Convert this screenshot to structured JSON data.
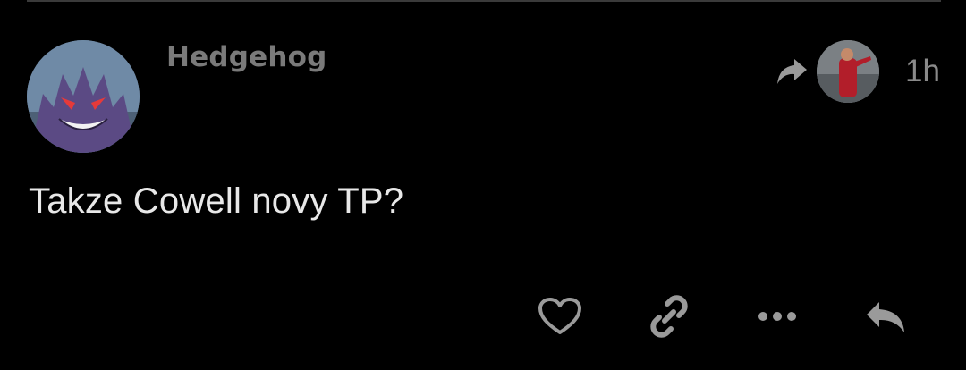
{
  "post": {
    "author": "Hedgehog",
    "time": "1h",
    "text": "Takze Cowell novy TP?"
  },
  "icons": {
    "avatar": "avatar-image",
    "boost": "boost-arrow-icon",
    "boost_avatar": "booster-avatar-image",
    "like": "heart-icon",
    "link": "link-icon",
    "more": "more-dots-icon",
    "reply": "reply-arrow-icon"
  },
  "colors": {
    "background": "#000000",
    "text": "#e8e8e8",
    "muted": "#8a8a8a",
    "icon": "#9a9a9a"
  }
}
